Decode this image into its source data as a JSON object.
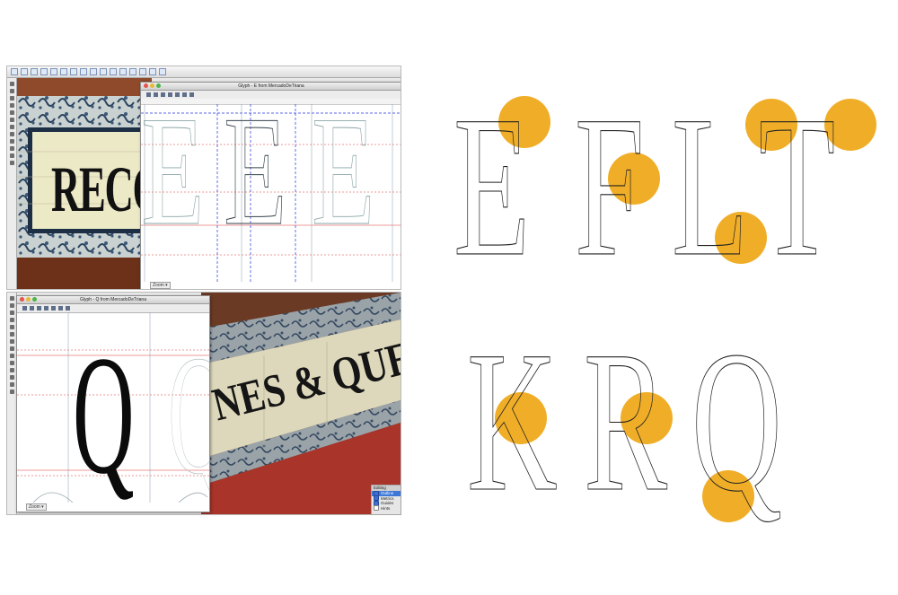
{
  "top_screenshot": {
    "photo_sign_text": "RECO",
    "glyph_window_title": "Glyph - E from MercadoDeTriana",
    "glyph_outlines": [
      "E",
      "E",
      "E"
    ],
    "zoom_label": "Zoom"
  },
  "bottom_screenshot": {
    "glyph_window_title": "Glyph - Q from MercadoDeTriana",
    "glyph_letter": "Q",
    "ghost_glyph": "Q",
    "photo_sign_text": "NES & QUE",
    "zoom_label": "Zoom",
    "panel_title": "Editing",
    "panel_options": [
      {
        "label": "Outline",
        "checked": true,
        "selected": true
      },
      {
        "label": "Metrics",
        "checked": true,
        "selected": false
      },
      {
        "label": "Guides",
        "checked": true,
        "selected": false
      },
      {
        "label": "Hints",
        "checked": false,
        "selected": false
      }
    ]
  },
  "outline_diagram": {
    "row_1": [
      "E",
      "F",
      "L",
      "T"
    ],
    "row_2": [
      "K",
      "R",
      "Q"
    ],
    "highlight_color": "#f0ae28",
    "outline_color": "#222222"
  }
}
